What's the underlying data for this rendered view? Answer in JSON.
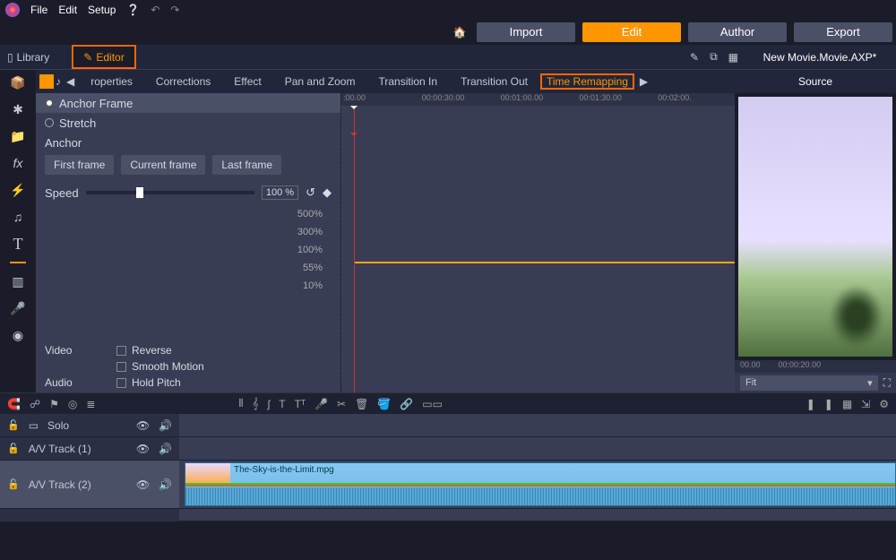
{
  "menu": {
    "file": "File",
    "edit": "Edit",
    "setup": "Setup"
  },
  "mainTabs": {
    "import": "Import",
    "edit": "Edit",
    "author": "Author",
    "export": "Export"
  },
  "row3": {
    "library": "Library",
    "editor": "Editor",
    "project": "New Movie.Movie.AXP*"
  },
  "subtabs": [
    "roperties",
    "Corrections",
    "Effect",
    "Pan and Zoom",
    "Transition In",
    "Transition Out",
    "Time Remapping"
  ],
  "props": {
    "anchorFrame": "Anchor Frame",
    "stretch": "Stretch",
    "anchor": "Anchor",
    "firstFrame": "First frame",
    "currentFrame": "Current frame",
    "lastFrame": "Last frame",
    "speed": "Speed",
    "speedVal": "100 %",
    "scale": [
      "500%",
      "300%",
      "100%",
      "55%",
      "10%"
    ],
    "video": "Video",
    "audio": "Audio",
    "reverse": "Reverse",
    "smooth": "Smooth Motion",
    "holdPitch": "Hold Pitch"
  },
  "timeline": {
    "marks": [
      ":00.00",
      "00:00:30.00",
      "00:01:00.00",
      "00:01:30.00",
      "00:02:00."
    ]
  },
  "preview": {
    "source": "Source",
    "t1": "00.00",
    "t2": "00:00:20.00",
    "fit": "Fit"
  },
  "tracks": {
    "solo": "Solo",
    "t1": "A/V Track (1)",
    "t2": "A/V Track (2)",
    "clip": "The-Sky-is-the-Limit.mpg"
  }
}
